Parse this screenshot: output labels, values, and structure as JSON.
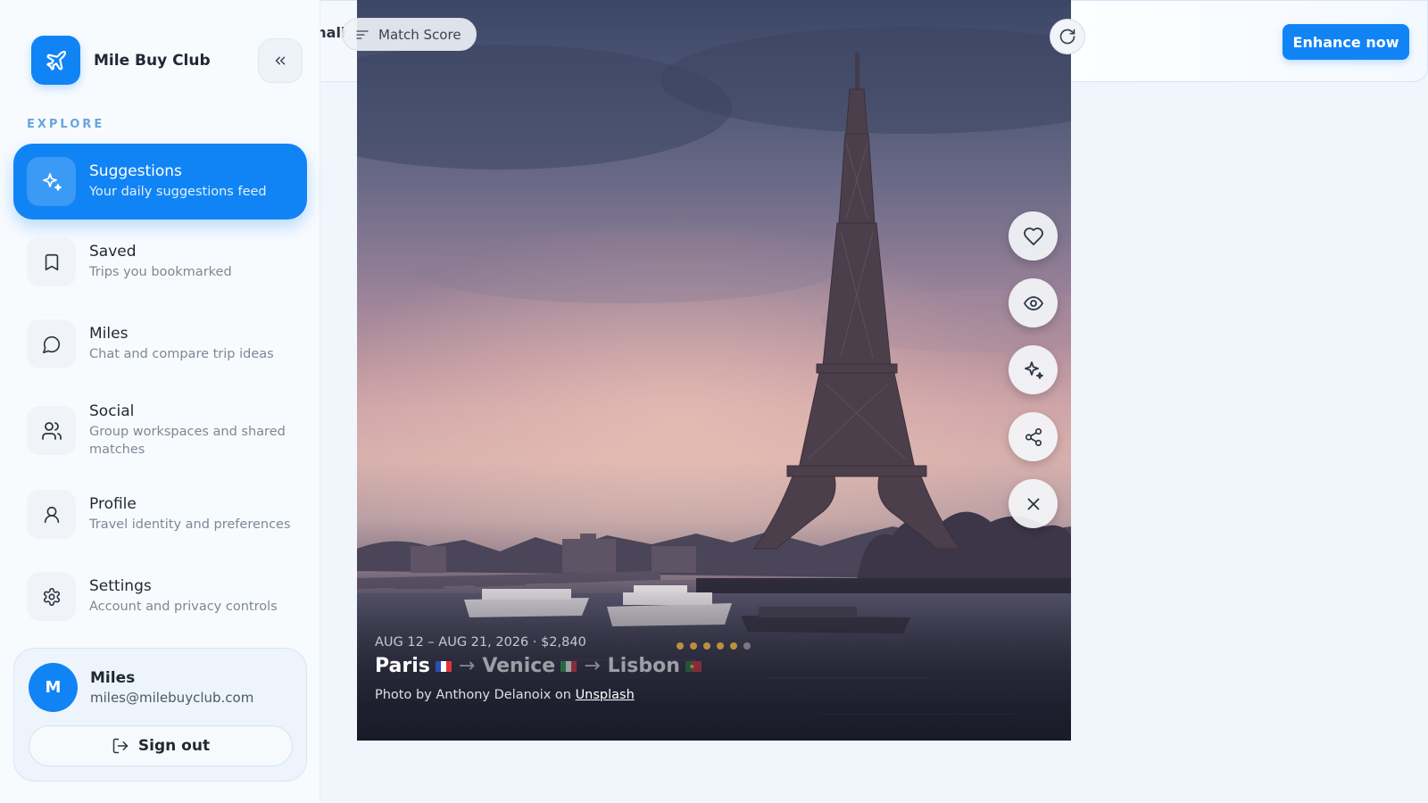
{
  "app": {
    "brand_name": "Mile Buy Club"
  },
  "topbar": {
    "title_partial": "ersonali",
    "enhance_label": "Enhance now"
  },
  "sidebar": {
    "section_label": "EXPLORE",
    "items": [
      {
        "label": "Suggestions",
        "sub": "Your daily suggestions feed",
        "icon": "sparkles-icon",
        "active": true
      },
      {
        "label": "Saved",
        "sub": "Trips you bookmarked",
        "icon": "bookmark-icon",
        "active": false
      },
      {
        "label": "Miles",
        "sub": "Chat and compare trip ideas",
        "icon": "chat-bubble-icon",
        "active": false
      },
      {
        "label": "Social",
        "sub": "Group workspaces and shared matches",
        "icon": "users-icon",
        "active": false
      },
      {
        "label": "Profile",
        "sub": "Travel identity and preferences",
        "icon": "user-icon",
        "active": false
      },
      {
        "label": "Settings",
        "sub": "Account and privacy controls",
        "icon": "gear-icon",
        "active": false
      }
    ],
    "user": {
      "initial": "M",
      "name": "Miles",
      "email": "miles@milebuyclub.com",
      "signout_label": "Sign out"
    }
  },
  "card": {
    "match_score_label": "Match Score",
    "dates_price": "AUG 12 – AUG 21, 2026 · $2,840",
    "route": {
      "city1": "Paris",
      "arrow": "→",
      "city2": "Venice",
      "city3": "Lisbon"
    },
    "credit_prefix": "Photo by Anthony Delanoix on",
    "credit_link": "Unsplash",
    "actions": [
      "heart-icon",
      "eye-icon",
      "sparkles-icon",
      "share-icon",
      "close-icon"
    ],
    "dots_total": 6,
    "dots_active": 5
  },
  "colors": {
    "accent": "#1184f5",
    "background": "#f1f6fd"
  }
}
